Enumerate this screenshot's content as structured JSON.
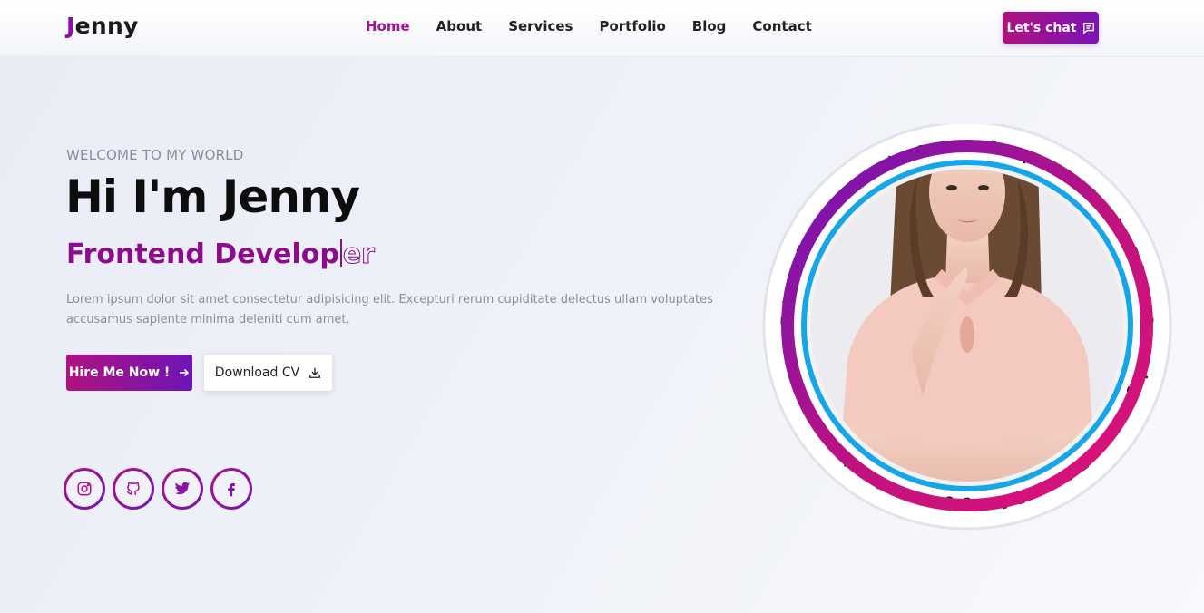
{
  "header": {
    "logo_first": "J",
    "logo_rest": "enny",
    "nav": [
      "Home",
      "About",
      "Services",
      "Portfolio",
      "Blog",
      "Contact"
    ],
    "active_nav": "Home",
    "chat_label": "Let's chat",
    "chat_icon": "chat-bubble-icon"
  },
  "hero": {
    "welcome": "WELCOME TO MY WORLD",
    "title": "Hi I'm Jenny",
    "role_main": "Frontend Develop",
    "role_tail": "er",
    "description": "Lorem ipsum dolor sit amet consectetur adipisicing elit. Excepturi rerum cupiditate delectus ullam voluptates accusamus sapiente minima deleniti cum amet.",
    "hire_label": "Hire Me Now !",
    "cv_label": "Download CV"
  },
  "socials": [
    {
      "name": "instagram",
      "icon": "instagram-icon"
    },
    {
      "name": "github",
      "icon": "github-icon"
    },
    {
      "name": "twitter",
      "icon": "twitter-icon"
    },
    {
      "name": "facebook",
      "icon": "facebook-icon"
    }
  ],
  "portrait": {
    "ring_text": "I'm Frontend Developer And I'm Designer I'm Blogger And "
  },
  "colors": {
    "accent": "#a0129a",
    "gradient_start": "#b0127f",
    "gradient_end": "#6d15b8",
    "ring_blue": "#16a6e8"
  }
}
